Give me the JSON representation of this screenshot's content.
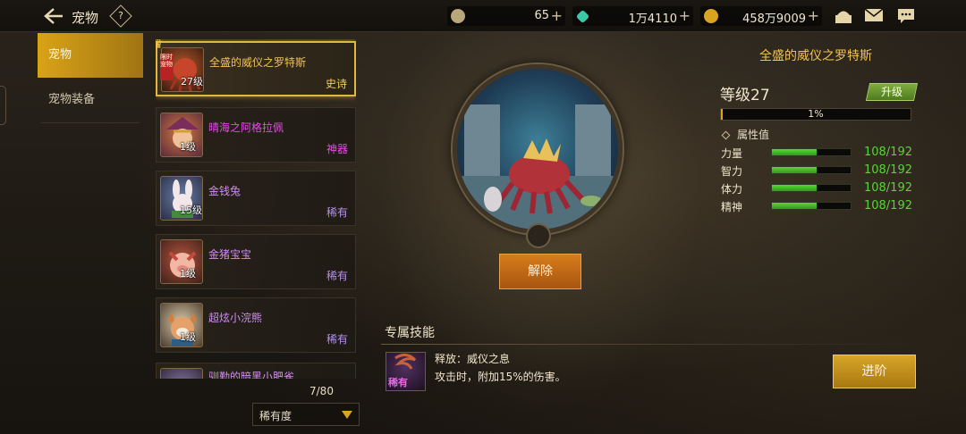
{
  "header": {
    "back_icon": "back-arrow-icon",
    "title": "宠物",
    "help_label": "?"
  },
  "resources": [
    {
      "name": "gold-coin",
      "value": "65",
      "color": "#b8a77a"
    },
    {
      "name": "gem",
      "value": "1万4110",
      "color": "#3ec7a6"
    },
    {
      "name": "coin",
      "value": "458万9009",
      "color": "#d9a520"
    }
  ],
  "top_icons": [
    "shop-icon",
    "mail-icon",
    "chat-icon"
  ],
  "tabs": [
    {
      "label": "宠物",
      "active": true
    },
    {
      "label": "宠物装备",
      "active": false
    }
  ],
  "pet_list": {
    "items": [
      {
        "name": "全盛的威仪之罗特斯",
        "level": "27级",
        "rarity": "史诗",
        "tier": "gold",
        "selected": true,
        "limited_tag": "限时宠物"
      },
      {
        "name": "晴海之阿格拉佩",
        "level": "1级",
        "rarity": "神器",
        "tier": "magenta",
        "selected": false
      },
      {
        "name": "金钱兔",
        "level": "15级",
        "rarity": "稀有",
        "tier": "purple",
        "selected": false
      },
      {
        "name": "金猪宝宝",
        "level": "1级",
        "rarity": "稀有",
        "tier": "purple",
        "selected": false
      },
      {
        "name": "超炫小浣熊",
        "level": "1级",
        "rarity": "稀有",
        "tier": "purple",
        "selected": false
      },
      {
        "name": "驯勤的暗黑小肥雀",
        "level": "",
        "rarity": "",
        "tier": "purple",
        "selected": false
      }
    ],
    "count": "7/80",
    "sort_label": "稀有度"
  },
  "selected_pet": {
    "name": "全盛的威仪之罗特斯",
    "level_text": "等级27",
    "upgrade_label": "升级",
    "exp_percent": 1,
    "exp_text": "1%",
    "release_label": "解除",
    "attributes_header": "属性值",
    "attributes": [
      {
        "name": "力量",
        "value": "108/192",
        "fraction": 0.5625
      },
      {
        "name": "智力",
        "value": "108/192",
        "fraction": 0.5625
      },
      {
        "name": "体力",
        "value": "108/192",
        "fraction": 0.5625
      },
      {
        "name": "精神",
        "value": "108/192",
        "fraction": 0.5625
      }
    ]
  },
  "skills": {
    "header": "专属技能",
    "name": "释放：威仪之息",
    "description": "攻击时，附加15%的伤害。",
    "tag": "稀有",
    "advance_label": "进阶"
  }
}
